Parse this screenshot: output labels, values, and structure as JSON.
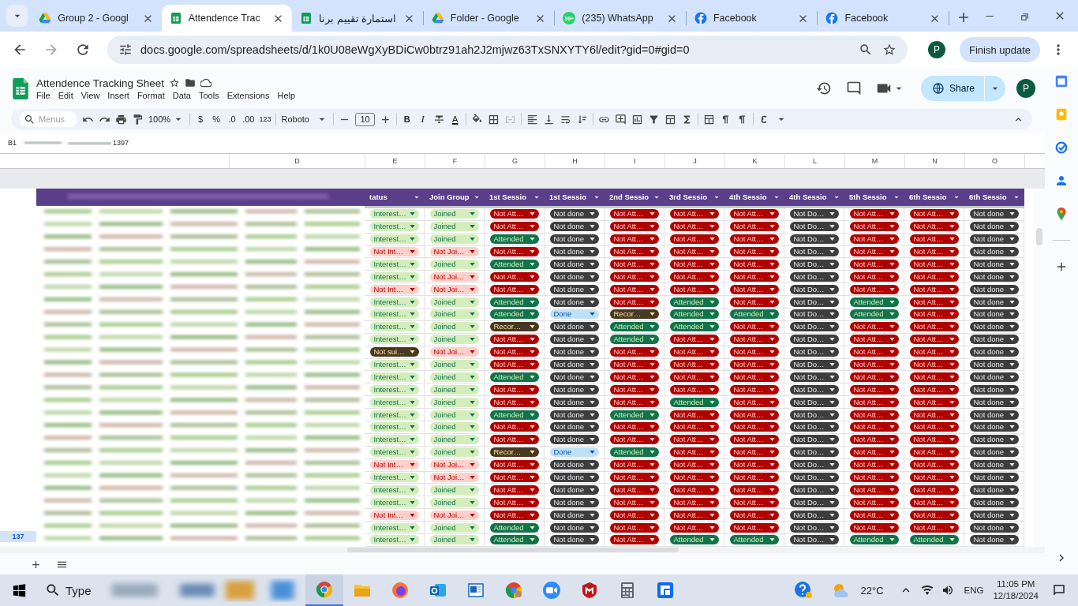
{
  "browser": {
    "tabs": [
      {
        "title": "Group 2 - Googl",
        "kind": "drive",
        "selected": false
      },
      {
        "title": "Attendence Trac",
        "kind": "sheets",
        "selected": true
      },
      {
        "title": "استمارة تقييم برنا",
        "kind": "sheets",
        "selected": false
      },
      {
        "title": "Folder - Google",
        "kind": "drive",
        "selected": false
      },
      {
        "title": "(235) WhatsApp",
        "kind": "chat",
        "badge": "99+",
        "selected": false
      },
      {
        "title": "Facebook",
        "kind": "facebook",
        "selected": false
      },
      {
        "title": "Facebook",
        "kind": "facebook",
        "selected": false
      }
    ],
    "url": "docs.google.com/spreadsheets/d/1k0U08eWgXyBDiCw0btrz91ah2J2mjwz63TxSNXYTY6l/edit?gid=0#gid=0",
    "profile": "P",
    "update_button": "Finish update"
  },
  "document": {
    "title": "Attendence Tracking Sheet",
    "menu": [
      "File",
      "Edit",
      "View",
      "Insert",
      "Format",
      "Data",
      "Tools",
      "Extensions",
      "Help"
    ],
    "share_button": "Share",
    "avatar": "P"
  },
  "toolbar": {
    "search": "Menus",
    "zoom": "100%",
    "currency": "$",
    "percent": "%",
    "decrease_decimals": ".0",
    "increase_decimals": ".00",
    "number_format": "123",
    "font": "Roboto",
    "font_size": "10",
    "bold": "B",
    "italic": "I",
    "text_color": "A"
  },
  "formula_bar": {
    "cell": "B1",
    "visible_value": "1397"
  },
  "columns": [
    "D",
    "E",
    "F",
    "G",
    "H",
    "I",
    "J",
    "K",
    "L",
    "M",
    "N",
    "O"
  ],
  "headers": [
    "tatus",
    "Join Group",
    "1st Sessio",
    "1st Sessio",
    "2nd Sessio",
    "3rd Sessio",
    "4th Sessio",
    "4th Sessio",
    "5th Sessio",
    "6th Sessio",
    "6th Sessio"
  ],
  "last_row_number": "137",
  "rows": [
    {
      "cells": [
        {
          "text": "Interest…",
          "kind": "interested"
        },
        {
          "text": "Joined",
          "kind": "joined"
        },
        {
          "text": "Not Att…",
          "kind": "not_attended"
        },
        {
          "text": "Not done",
          "kind": "not_done"
        },
        {
          "text": "Not Att…",
          "kind": "not_attended"
        },
        {
          "text": "Not Att…",
          "kind": "not_attended"
        },
        {
          "text": "Not Att…",
          "kind": "not_attended"
        },
        {
          "text": "Not Do…",
          "kind": "not_done"
        },
        {
          "text": "Not Att…",
          "kind": "not_attended"
        },
        {
          "text": "Not Att…",
          "kind": "not_attended"
        },
        {
          "text": "Not done",
          "kind": "not_done"
        }
      ]
    },
    {
      "cells": [
        {
          "text": "Interest…",
          "kind": "interested"
        },
        {
          "text": "Joined",
          "kind": "joined"
        },
        {
          "text": "Not Att…",
          "kind": "not_attended"
        },
        {
          "text": "Not done",
          "kind": "not_done"
        },
        {
          "text": "Not Att…",
          "kind": "not_attended"
        },
        {
          "text": "Not Att…",
          "kind": "not_attended"
        },
        {
          "text": "Not Att…",
          "kind": "not_attended"
        },
        {
          "text": "Not Do…",
          "kind": "not_done"
        },
        {
          "text": "Not Att…",
          "kind": "not_attended"
        },
        {
          "text": "Not Att…",
          "kind": "not_attended"
        },
        {
          "text": "Not done",
          "kind": "not_done"
        }
      ]
    },
    {
      "cells": [
        {
          "text": "Interest…",
          "kind": "interested"
        },
        {
          "text": "Joined",
          "kind": "joined"
        },
        {
          "text": "Attended",
          "kind": "attended"
        },
        {
          "text": "Not done",
          "kind": "not_done"
        },
        {
          "text": "Not Att…",
          "kind": "not_attended"
        },
        {
          "text": "Not Att…",
          "kind": "not_attended"
        },
        {
          "text": "Not Att…",
          "kind": "not_attended"
        },
        {
          "text": "Not Do…",
          "kind": "not_done"
        },
        {
          "text": "Not Att…",
          "kind": "not_attended"
        },
        {
          "text": "Not Att…",
          "kind": "not_attended"
        },
        {
          "text": "Not done",
          "kind": "not_done"
        }
      ]
    },
    {
      "cells": [
        {
          "text": "Not Int…",
          "kind": "not_interested"
        },
        {
          "text": "Not Joi…",
          "kind": "not_joined"
        },
        {
          "text": "Not Att…",
          "kind": "not_attended"
        },
        {
          "text": "Not done",
          "kind": "not_done"
        },
        {
          "text": "Not Att…",
          "kind": "not_attended"
        },
        {
          "text": "Not Att…",
          "kind": "not_attended"
        },
        {
          "text": "Not Att…",
          "kind": "not_attended"
        },
        {
          "text": "Not Do…",
          "kind": "not_done"
        },
        {
          "text": "Not Att…",
          "kind": "not_attended"
        },
        {
          "text": "Not Att…",
          "kind": "not_attended"
        },
        {
          "text": "Not done",
          "kind": "not_done"
        }
      ]
    },
    {
      "cells": [
        {
          "text": "Interest…",
          "kind": "interested"
        },
        {
          "text": "Joined",
          "kind": "joined"
        },
        {
          "text": "Attended",
          "kind": "attended"
        },
        {
          "text": "Not done",
          "kind": "not_done"
        },
        {
          "text": "Not Att…",
          "kind": "not_attended"
        },
        {
          "text": "Not Att…",
          "kind": "not_attended"
        },
        {
          "text": "Not Att…",
          "kind": "not_attended"
        },
        {
          "text": "Not Do…",
          "kind": "not_done"
        },
        {
          "text": "Not Att…",
          "kind": "not_attended"
        },
        {
          "text": "Not Att…",
          "kind": "not_attended"
        },
        {
          "text": "Not done",
          "kind": "not_done"
        }
      ]
    },
    {
      "cells": [
        {
          "text": "Interest…",
          "kind": "interested"
        },
        {
          "text": "Not Joi…",
          "kind": "not_joined"
        },
        {
          "text": "Not Att…",
          "kind": "not_attended"
        },
        {
          "text": "Not done",
          "kind": "not_done"
        },
        {
          "text": "Not Att…",
          "kind": "not_attended"
        },
        {
          "text": "Not Att…",
          "kind": "not_attended"
        },
        {
          "text": "Not Att…",
          "kind": "not_attended"
        },
        {
          "text": "Not Do…",
          "kind": "not_done"
        },
        {
          "text": "Not Att…",
          "kind": "not_attended"
        },
        {
          "text": "Not Att…",
          "kind": "not_attended"
        },
        {
          "text": "Not done",
          "kind": "not_done"
        }
      ]
    },
    {
      "cells": [
        {
          "text": "Not Int…",
          "kind": "not_interested"
        },
        {
          "text": "Not Joi…",
          "kind": "not_joined"
        },
        {
          "text": "Not Att…",
          "kind": "not_attended"
        },
        {
          "text": "Not done",
          "kind": "not_done"
        },
        {
          "text": "Not Att…",
          "kind": "not_attended"
        },
        {
          "text": "Not Att…",
          "kind": "not_attended"
        },
        {
          "text": "Not Att…",
          "kind": "not_attended"
        },
        {
          "text": "Not Do…",
          "kind": "not_done"
        },
        {
          "text": "Not Att…",
          "kind": "not_attended"
        },
        {
          "text": "Not Att…",
          "kind": "not_attended"
        },
        {
          "text": "Not done",
          "kind": "not_done"
        }
      ]
    },
    {
      "cells": [
        {
          "text": "Interest…",
          "kind": "interested"
        },
        {
          "text": "Joined",
          "kind": "joined"
        },
        {
          "text": "Attended",
          "kind": "attended"
        },
        {
          "text": "Not done",
          "kind": "not_done"
        },
        {
          "text": "Not Att…",
          "kind": "not_attended"
        },
        {
          "text": "Attended",
          "kind": "attended"
        },
        {
          "text": "Not Att…",
          "kind": "not_attended"
        },
        {
          "text": "Not Do…",
          "kind": "not_done"
        },
        {
          "text": "Attended",
          "kind": "attended"
        },
        {
          "text": "Not Att…",
          "kind": "not_attended"
        },
        {
          "text": "Not done",
          "kind": "not_done"
        }
      ]
    },
    {
      "cells": [
        {
          "text": "Interest…",
          "kind": "interested"
        },
        {
          "text": "Joined",
          "kind": "joined"
        },
        {
          "text": "Attended",
          "kind": "attended"
        },
        {
          "text": "Done",
          "kind": "done"
        },
        {
          "text": "Recor…",
          "kind": "recorded"
        },
        {
          "text": "Attended",
          "kind": "attended"
        },
        {
          "text": "Attended",
          "kind": "attended"
        },
        {
          "text": "Not Do…",
          "kind": "not_done"
        },
        {
          "text": "Attended",
          "kind": "attended"
        },
        {
          "text": "Not Att…",
          "kind": "not_attended"
        },
        {
          "text": "Not done",
          "kind": "not_done"
        }
      ]
    },
    {
      "cells": [
        {
          "text": "Interest…",
          "kind": "interested"
        },
        {
          "text": "Joined",
          "kind": "joined"
        },
        {
          "text": "Recor…",
          "kind": "recorded"
        },
        {
          "text": "Not done",
          "kind": "not_done"
        },
        {
          "text": "Attended",
          "kind": "attended"
        },
        {
          "text": "Attended",
          "kind": "attended"
        },
        {
          "text": "Not Att…",
          "kind": "not_attended"
        },
        {
          "text": "Not Do…",
          "kind": "not_done"
        },
        {
          "text": "Not Att…",
          "kind": "not_attended"
        },
        {
          "text": "Not Att…",
          "kind": "not_attended"
        },
        {
          "text": "Not done",
          "kind": "not_done"
        }
      ]
    },
    {
      "cells": [
        {
          "text": "Interest…",
          "kind": "interested"
        },
        {
          "text": "Joined",
          "kind": "joined"
        },
        {
          "text": "Not Att…",
          "kind": "not_attended"
        },
        {
          "text": "Not done",
          "kind": "not_done"
        },
        {
          "text": "Attended",
          "kind": "attended"
        },
        {
          "text": "Not Att…",
          "kind": "not_attended"
        },
        {
          "text": "Not Att…",
          "kind": "not_attended"
        },
        {
          "text": "Not Do…",
          "kind": "not_done"
        },
        {
          "text": "Not Att…",
          "kind": "not_attended"
        },
        {
          "text": "Not Att…",
          "kind": "not_attended"
        },
        {
          "text": "Not done",
          "kind": "not_done"
        }
      ]
    },
    {
      "cells": [
        {
          "text": "Not sui…",
          "kind": "not_suitable"
        },
        {
          "text": "Not Joi…",
          "kind": "not_joined"
        },
        {
          "text": "Not Att…",
          "kind": "not_attended"
        },
        {
          "text": "Not done",
          "kind": "not_done"
        },
        {
          "text": "Not Att…",
          "kind": "not_attended"
        },
        {
          "text": "Not Att…",
          "kind": "not_attended"
        },
        {
          "text": "Not Att…",
          "kind": "not_attended"
        },
        {
          "text": "Not Do…",
          "kind": "not_done"
        },
        {
          "text": "Not Att…",
          "kind": "not_attended"
        },
        {
          "text": "Not Att…",
          "kind": "not_attended"
        },
        {
          "text": "Not done",
          "kind": "not_done"
        }
      ]
    },
    {
      "cells": [
        {
          "text": "Interest…",
          "kind": "interested"
        },
        {
          "text": "Joined",
          "kind": "joined"
        },
        {
          "text": "Not Att…",
          "kind": "not_attended"
        },
        {
          "text": "Not done",
          "kind": "not_done"
        },
        {
          "text": "Not Att…",
          "kind": "not_attended"
        },
        {
          "text": "Not Att…",
          "kind": "not_attended"
        },
        {
          "text": "Not Att…",
          "kind": "not_attended"
        },
        {
          "text": "Not Do…",
          "kind": "not_done"
        },
        {
          "text": "Not Att…",
          "kind": "not_attended"
        },
        {
          "text": "Not Att…",
          "kind": "not_attended"
        },
        {
          "text": "Not done",
          "kind": "not_done"
        }
      ]
    },
    {
      "cells": [
        {
          "text": "Interest…",
          "kind": "interested"
        },
        {
          "text": "Joined",
          "kind": "joined"
        },
        {
          "text": "Attended",
          "kind": "attended"
        },
        {
          "text": "Not done",
          "kind": "not_done"
        },
        {
          "text": "Not Att…",
          "kind": "not_attended"
        },
        {
          "text": "Not Att…",
          "kind": "not_attended"
        },
        {
          "text": "Not Att…",
          "kind": "not_attended"
        },
        {
          "text": "Not Do…",
          "kind": "not_done"
        },
        {
          "text": "Not Att…",
          "kind": "not_attended"
        },
        {
          "text": "Not Att…",
          "kind": "not_attended"
        },
        {
          "text": "Not done",
          "kind": "not_done"
        }
      ]
    },
    {
      "cells": [
        {
          "text": "Interest…",
          "kind": "interested"
        },
        {
          "text": "Joined",
          "kind": "joined"
        },
        {
          "text": "Not Att…",
          "kind": "not_attended"
        },
        {
          "text": "Not done",
          "kind": "not_done"
        },
        {
          "text": "Not Att…",
          "kind": "not_attended"
        },
        {
          "text": "Not Att…",
          "kind": "not_attended"
        },
        {
          "text": "Not Att…",
          "kind": "not_attended"
        },
        {
          "text": "Not Do…",
          "kind": "not_done"
        },
        {
          "text": "Not Att…",
          "kind": "not_attended"
        },
        {
          "text": "Not Att…",
          "kind": "not_attended"
        },
        {
          "text": "Not done",
          "kind": "not_done"
        }
      ]
    },
    {
      "cells": [
        {
          "text": "Interest…",
          "kind": "interested"
        },
        {
          "text": "Joined",
          "kind": "joined"
        },
        {
          "text": "Not Att…",
          "kind": "not_attended"
        },
        {
          "text": "Not done",
          "kind": "not_done"
        },
        {
          "text": "Not Att…",
          "kind": "not_attended"
        },
        {
          "text": "Attended",
          "kind": "attended"
        },
        {
          "text": "Not Att…",
          "kind": "not_attended"
        },
        {
          "text": "Not Do…",
          "kind": "not_done"
        },
        {
          "text": "Not Att…",
          "kind": "not_attended"
        },
        {
          "text": "Not Att…",
          "kind": "not_attended"
        },
        {
          "text": "Not done",
          "kind": "not_done"
        }
      ]
    },
    {
      "cells": [
        {
          "text": "Interest…",
          "kind": "interested"
        },
        {
          "text": "Joined",
          "kind": "joined"
        },
        {
          "text": "Attended",
          "kind": "attended"
        },
        {
          "text": "Not done",
          "kind": "not_done"
        },
        {
          "text": "Attended",
          "kind": "attended"
        },
        {
          "text": "Not Att…",
          "kind": "not_attended"
        },
        {
          "text": "Not Att…",
          "kind": "not_attended"
        },
        {
          "text": "Not Do…",
          "kind": "not_done"
        },
        {
          "text": "Not Att…",
          "kind": "not_attended"
        },
        {
          "text": "Not Att…",
          "kind": "not_attended"
        },
        {
          "text": "Not done",
          "kind": "not_done"
        }
      ]
    },
    {
      "cells": [
        {
          "text": "Interest…",
          "kind": "interested"
        },
        {
          "text": "Joined",
          "kind": "joined"
        },
        {
          "text": "Not Att…",
          "kind": "not_attended"
        },
        {
          "text": "Not done",
          "kind": "not_done"
        },
        {
          "text": "Not Att…",
          "kind": "not_attended"
        },
        {
          "text": "Not Att…",
          "kind": "not_attended"
        },
        {
          "text": "Not Att…",
          "kind": "not_attended"
        },
        {
          "text": "Not Do…",
          "kind": "not_done"
        },
        {
          "text": "Not Att…",
          "kind": "not_attended"
        },
        {
          "text": "Not Att…",
          "kind": "not_attended"
        },
        {
          "text": "Not done",
          "kind": "not_done"
        }
      ]
    },
    {
      "cells": [
        {
          "text": "Interest…",
          "kind": "interested"
        },
        {
          "text": "Joined",
          "kind": "joined"
        },
        {
          "text": "Not Att…",
          "kind": "not_attended"
        },
        {
          "text": "Not done",
          "kind": "not_done"
        },
        {
          "text": "Not Att…",
          "kind": "not_attended"
        },
        {
          "text": "Not Att…",
          "kind": "not_attended"
        },
        {
          "text": "Not Att…",
          "kind": "not_attended"
        },
        {
          "text": "Not Do…",
          "kind": "not_done"
        },
        {
          "text": "Not Att…",
          "kind": "not_attended"
        },
        {
          "text": "Not Att…",
          "kind": "not_attended"
        },
        {
          "text": "Not done",
          "kind": "not_done"
        }
      ]
    },
    {
      "cells": [
        {
          "text": "Interest…",
          "kind": "interested"
        },
        {
          "text": "Joined",
          "kind": "joined"
        },
        {
          "text": "Recor…",
          "kind": "recorded"
        },
        {
          "text": "Done",
          "kind": "done"
        },
        {
          "text": "Attended",
          "kind": "attended"
        },
        {
          "text": "Not Att…",
          "kind": "not_attended"
        },
        {
          "text": "Not Att…",
          "kind": "not_attended"
        },
        {
          "text": "Not Do…",
          "kind": "not_done"
        },
        {
          "text": "Not Att…",
          "kind": "not_attended"
        },
        {
          "text": "Not Att…",
          "kind": "not_attended"
        },
        {
          "text": "Not done",
          "kind": "not_done"
        }
      ]
    },
    {
      "cells": [
        {
          "text": "Not Int…",
          "kind": "not_interested"
        },
        {
          "text": "Not Joi…",
          "kind": "not_joined"
        },
        {
          "text": "Not Att…",
          "kind": "not_attended"
        },
        {
          "text": "Not done",
          "kind": "not_done"
        },
        {
          "text": "Not Att…",
          "kind": "not_attended"
        },
        {
          "text": "Not Att…",
          "kind": "not_attended"
        },
        {
          "text": "Not Att…",
          "kind": "not_attended"
        },
        {
          "text": "Not Do…",
          "kind": "not_done"
        },
        {
          "text": "Not Att…",
          "kind": "not_attended"
        },
        {
          "text": "Not Att…",
          "kind": "not_attended"
        },
        {
          "text": "Not done",
          "kind": "not_done"
        }
      ]
    },
    {
      "cells": [
        {
          "text": "Interest…",
          "kind": "interested"
        },
        {
          "text": "Not Joi…",
          "kind": "not_joined"
        },
        {
          "text": "Not Att…",
          "kind": "not_attended"
        },
        {
          "text": "Not done",
          "kind": "not_done"
        },
        {
          "text": "Not Att…",
          "kind": "not_attended"
        },
        {
          "text": "Not Att…",
          "kind": "not_attended"
        },
        {
          "text": "Not Att…",
          "kind": "not_attended"
        },
        {
          "text": "Not Do…",
          "kind": "not_done"
        },
        {
          "text": "Not Att…",
          "kind": "not_attended"
        },
        {
          "text": "Not Att…",
          "kind": "not_attended"
        },
        {
          "text": "Not done",
          "kind": "not_done"
        }
      ]
    },
    {
      "cells": [
        {
          "text": "Interest…",
          "kind": "interested"
        },
        {
          "text": "Joined",
          "kind": "joined"
        },
        {
          "text": "Not Att…",
          "kind": "not_attended"
        },
        {
          "text": "Not done",
          "kind": "not_done"
        },
        {
          "text": "Not Att…",
          "kind": "not_attended"
        },
        {
          "text": "Not Att…",
          "kind": "not_attended"
        },
        {
          "text": "Not Att…",
          "kind": "not_attended"
        },
        {
          "text": "Not Do…",
          "kind": "not_done"
        },
        {
          "text": "Not Att…",
          "kind": "not_attended"
        },
        {
          "text": "Not Att…",
          "kind": "not_attended"
        },
        {
          "text": "Not done",
          "kind": "not_done"
        }
      ]
    },
    {
      "cells": [
        {
          "text": "Interest…",
          "kind": "interested"
        },
        {
          "text": "Joined",
          "kind": "joined"
        },
        {
          "text": "Not Att…",
          "kind": "not_attended"
        },
        {
          "text": "Not done",
          "kind": "not_done"
        },
        {
          "text": "Not Att…",
          "kind": "not_attended"
        },
        {
          "text": "Not Att…",
          "kind": "not_attended"
        },
        {
          "text": "Not Att…",
          "kind": "not_attended"
        },
        {
          "text": "Not Do…",
          "kind": "not_done"
        },
        {
          "text": "Not Att…",
          "kind": "not_attended"
        },
        {
          "text": "Not Att…",
          "kind": "not_attended"
        },
        {
          "text": "Not done",
          "kind": "not_done"
        }
      ]
    },
    {
      "cells": [
        {
          "text": "Not Int…",
          "kind": "not_interested"
        },
        {
          "text": "Not Joi…",
          "kind": "not_joined"
        },
        {
          "text": "Not Att…",
          "kind": "not_attended"
        },
        {
          "text": "Not done",
          "kind": "not_done"
        },
        {
          "text": "Not Att…",
          "kind": "not_attended"
        },
        {
          "text": "Not Att…",
          "kind": "not_attended"
        },
        {
          "text": "Not Att…",
          "kind": "not_attended"
        },
        {
          "text": "Not Do…",
          "kind": "not_done"
        },
        {
          "text": "Not Att…",
          "kind": "not_attended"
        },
        {
          "text": "Not Att…",
          "kind": "not_attended"
        },
        {
          "text": "Not done",
          "kind": "not_done"
        }
      ]
    },
    {
      "cells": [
        {
          "text": "Interest…",
          "kind": "interested"
        },
        {
          "text": "Joined",
          "kind": "joined"
        },
        {
          "text": "Attended",
          "kind": "attended"
        },
        {
          "text": "Not done",
          "kind": "not_done"
        },
        {
          "text": "Not Att…",
          "kind": "not_attended"
        },
        {
          "text": "Not Att…",
          "kind": "not_attended"
        },
        {
          "text": "Not Att…",
          "kind": "not_attended"
        },
        {
          "text": "Not Do…",
          "kind": "not_done"
        },
        {
          "text": "Not Att…",
          "kind": "not_attended"
        },
        {
          "text": "Not Att…",
          "kind": "not_attended"
        },
        {
          "text": "Not done",
          "kind": "not_done"
        }
      ]
    },
    {
      "cells": [
        {
          "text": "Interest…",
          "kind": "interested"
        },
        {
          "text": "Joined",
          "kind": "joined"
        },
        {
          "text": "Attended",
          "kind": "attended"
        },
        {
          "text": "Not done",
          "kind": "not_done"
        },
        {
          "text": "Not Att…",
          "kind": "not_attended"
        },
        {
          "text": "Attended",
          "kind": "attended"
        },
        {
          "text": "Attended",
          "kind": "attended"
        },
        {
          "text": "Not Do…",
          "kind": "not_done"
        },
        {
          "text": "Attended",
          "kind": "attended"
        },
        {
          "text": "Attended",
          "kind": "attended"
        },
        {
          "text": "Not done",
          "kind": "not_done"
        }
      ]
    }
  ],
  "taskbar": {
    "search": "Type",
    "temperature": "22°C",
    "language": "ENG",
    "time": "11:05 PM",
    "date": "12/18/2024"
  }
}
